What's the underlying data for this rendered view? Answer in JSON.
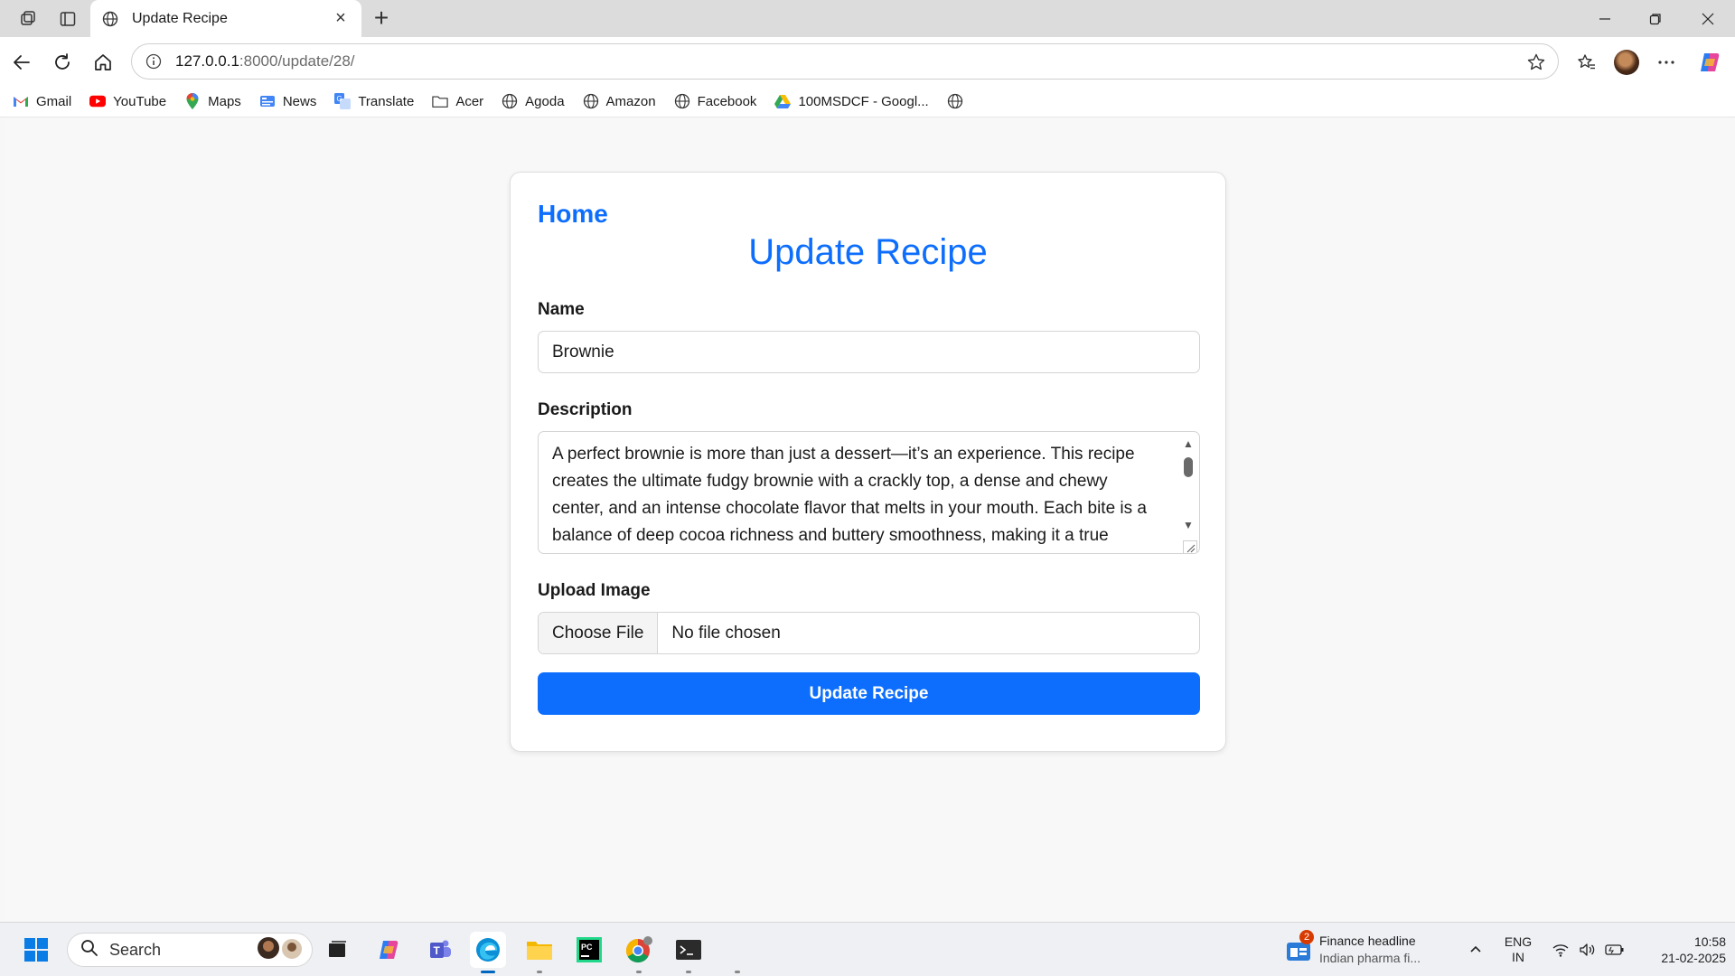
{
  "browser": {
    "tab_title": "Update Recipe",
    "url_host": "127.0.0.1",
    "url_path": ":8000/update/28/",
    "bookmarks": [
      {
        "label": "Gmail",
        "icon": "gmail-icon"
      },
      {
        "label": "YouTube",
        "icon": "youtube-icon"
      },
      {
        "label": "Maps",
        "icon": "maps-icon"
      },
      {
        "label": "News",
        "icon": "news-icon"
      },
      {
        "label": "Translate",
        "icon": "translate-icon"
      },
      {
        "label": "Acer",
        "icon": "folder-icon"
      },
      {
        "label": "Agoda",
        "icon": "globe-icon"
      },
      {
        "label": "Amazon",
        "icon": "globe-icon"
      },
      {
        "label": "Facebook",
        "icon": "globe-icon"
      },
      {
        "label": "100MSDCF - Googl...",
        "icon": "drive-icon"
      }
    ]
  },
  "page": {
    "home_link": "Home",
    "title": "Update Recipe",
    "name_label": "Name",
    "name_value": "Brownie",
    "description_label": "Description",
    "description_value": "A perfect brownie is more than just a dessert—it’s an experience. This recipe creates the ultimate fudgy brownie with a crackly top, a dense and chewy center, and an intense chocolate flavor that melts in your mouth. Each bite is a balance of deep cocoa richness and buttery smoothness, making it a true",
    "upload_label": "Upload Image",
    "choose_file_label": "Choose File",
    "no_file_text": "No file chosen",
    "submit_label": "Update Recipe"
  },
  "taskbar": {
    "search_placeholder": "Search",
    "news_badge": "2",
    "news_title": "Finance headline",
    "news_subtitle": "Indian pharma fi...",
    "lang_top": "ENG",
    "lang_bottom": "IN",
    "time": "10:58",
    "date": "21-02-2025"
  },
  "colors": {
    "accent": "#0d6efd",
    "page_bg": "#f8f8f8",
    "card_bg": "#ffffff"
  }
}
